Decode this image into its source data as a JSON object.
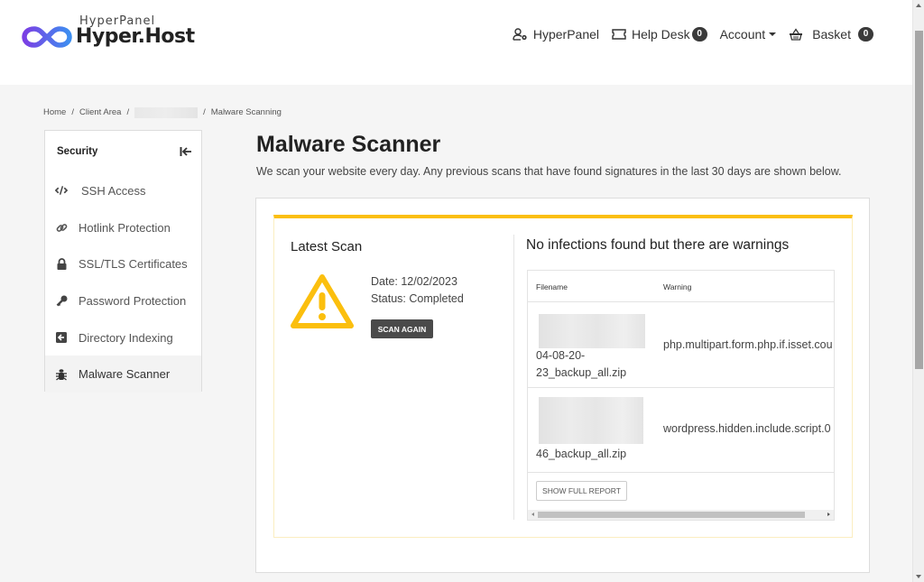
{
  "brand": {
    "subtitle": "HyperPanel",
    "name": "Hyper.Host",
    "gradient": [
      "#7b3fe4",
      "#3d8ef0"
    ]
  },
  "topnav": {
    "items": [
      {
        "label": "HyperPanel",
        "icon": "user-cog-icon"
      },
      {
        "label": "Help Desk",
        "icon": "ticket-icon",
        "badge": "0"
      },
      {
        "label": "Account",
        "icon": "caret-down-icon"
      },
      {
        "label": "Basket",
        "icon": "basket-icon",
        "badge": "0"
      }
    ]
  },
  "breadcrumb": {
    "items": [
      "Home",
      "Client Area",
      "",
      "Malware Scanning"
    ],
    "separator": "/"
  },
  "sidebar": {
    "title": "Security",
    "collapse_icon": "collapse-left-icon",
    "items": [
      {
        "label": "SSH Access",
        "icon": "code-icon"
      },
      {
        "label": "Hotlink Protection",
        "icon": "link-icon"
      },
      {
        "label": "SSL/TLS Certificates",
        "icon": "lock-icon"
      },
      {
        "label": "Password Protection",
        "icon": "key-icon"
      },
      {
        "label": "Directory Indexing",
        "icon": "folder-arrow-icon"
      },
      {
        "label": "Malware Scanner",
        "icon": "bug-icon",
        "active": true
      }
    ]
  },
  "main": {
    "title": "Malware Scanner",
    "description": "We scan your website every day. Any previous scans that have found signatures in the last 30 days are shown below.",
    "accent_color": "#fbbf0e",
    "latest_scan": {
      "title": "Latest Scan",
      "date": "Date: 12/02/2023",
      "status": "Status: Completed",
      "button": "SCAN AGAIN"
    },
    "results": {
      "title": "No infections found but there are warnings",
      "columns": [
        "Filename",
        "Warning"
      ],
      "rows": [
        {
          "filename_visible": [
            "04-08-20-",
            "23_backup_all.zip"
          ],
          "warning": "php.multipart.form.php.if.isset.cou"
        },
        {
          "filename_visible": [
            "46_backup_all.zip"
          ],
          "warning": "wordpress.hidden.include.script.0"
        }
      ],
      "button": "SHOW FULL REPORT"
    }
  }
}
